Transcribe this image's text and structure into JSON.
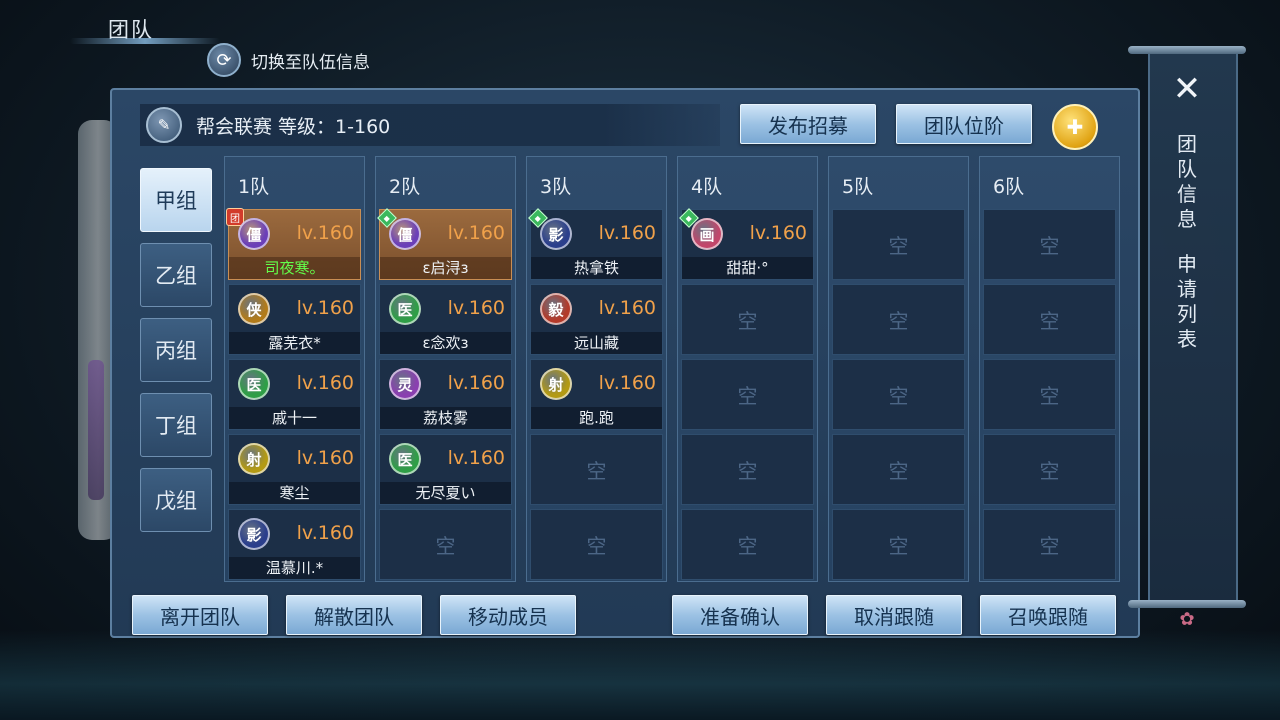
{
  "window_title": "团队",
  "switch_button": {
    "label": "切换至队伍信息",
    "icon": "refresh-icon"
  },
  "header": {
    "title": "帮会联赛 等级：1-160"
  },
  "top_buttons": {
    "publish": "发布招募",
    "rank": "团队位阶"
  },
  "groups": [
    "甲组",
    "乙组",
    "丙组",
    "丁组",
    "戊组"
  ],
  "active_group": "甲组",
  "empty_label": "空",
  "teams": [
    {
      "label": "1队",
      "members": [
        {
          "job": "僵",
          "job_color": "#6b3fb8",
          "level": "lv.160",
          "name": "司夜寒。",
          "leader": true,
          "badge": "团",
          "highlight": true
        },
        {
          "job": "侠",
          "job_color": "#b27b1a",
          "level": "lv.160",
          "name": "露芜衣*"
        },
        {
          "job": "医",
          "job_color": "#2f9e46",
          "level": "lv.160",
          "name": "戚十一"
        },
        {
          "job": "射",
          "job_color": "#b39a14",
          "level": "lv.160",
          "name": "寒尘"
        },
        {
          "job": "影",
          "job_color": "#2b3f8c",
          "level": "lv.160",
          "name": "温慕川.*"
        }
      ]
    },
    {
      "label": "2队",
      "members": [
        {
          "job": "僵",
          "job_color": "#6b3fb8",
          "level": "lv.160",
          "name": "ε启浔з",
          "leader": true,
          "badge": "gem"
        },
        {
          "job": "医",
          "job_color": "#2f9e46",
          "level": "lv.160",
          "name": "ε念欢з"
        },
        {
          "job": "灵",
          "job_color": "#8a3fb0",
          "level": "lv.160",
          "name": "荔枝雾"
        },
        {
          "job": "医",
          "job_color": "#2f9e46",
          "level": "lv.160",
          "name": "无尽夏い"
        }
      ]
    },
    {
      "label": "3队",
      "members": [
        {
          "job": "影",
          "job_color": "#2b3f8c",
          "level": "lv.160",
          "name": "热拿铁",
          "badge": "gem"
        },
        {
          "job": "毅",
          "job_color": "#b33a2a",
          "level": "lv.160",
          "name": "远山藏"
        },
        {
          "job": "射",
          "job_color": "#b39a14",
          "level": "lv.160",
          "name": "跑.跑"
        }
      ]
    },
    {
      "label": "4队",
      "members": [
        {
          "job": "画",
          "job_color": "#c2476b",
          "level": "lv.160",
          "name": "甜甜·°",
          "badge": "gem"
        }
      ]
    },
    {
      "label": "5队",
      "members": []
    },
    {
      "label": "6队",
      "members": []
    }
  ],
  "bottom_buttons": {
    "leave": "离开团队",
    "disband": "解散团队",
    "move": "移动成员",
    "ready": "准备确认",
    "unfollow": "取消跟随",
    "summon": "召唤跟随"
  },
  "side_banner": {
    "team_info": "团队信息",
    "apply_list": "申请列表"
  }
}
